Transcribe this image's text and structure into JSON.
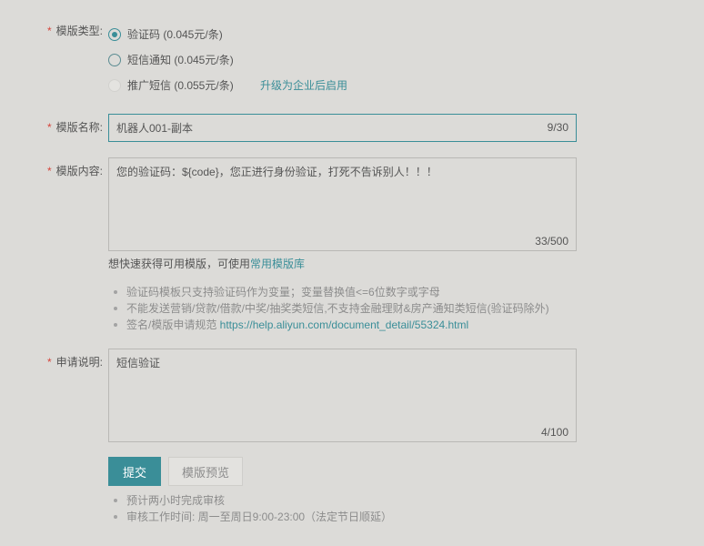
{
  "colors": {
    "background": "#dcdbd8",
    "accent": "#3a8e98",
    "required": "#d6453b",
    "text": "#555555",
    "muted": "#8c8c8c"
  },
  "template_type": {
    "required_mark": "*",
    "label": "模版类型:",
    "options": [
      {
        "label": "验证码 (0.045元/条)",
        "selected": true,
        "disabled": false
      },
      {
        "label": "短信通知 (0.045元/条)",
        "selected": false,
        "disabled": false
      },
      {
        "label": "推广短信 (0.055元/条)",
        "selected": false,
        "disabled": true
      }
    ],
    "upgrade_link": "升级为企业后启用"
  },
  "template_name": {
    "required_mark": "*",
    "label": "模版名称:",
    "value": "机器人001-副本",
    "counter": "9/30"
  },
  "template_content": {
    "required_mark": "*",
    "label": "模版内容:",
    "value": "您的验证码：${code}，您正进行身份验证，打死不告诉别人！！！",
    "counter": "33/500",
    "hint_prefix": "想快速获得可用模版，可使用",
    "hint_link": "常用模版库",
    "rules": [
      {
        "text": "验证码模板只支持验证码作为变量；变量替换值<=6位数字或字母"
      },
      {
        "text": "不能发送营销/贷款/借款/中奖/抽奖类短信,不支持金融理财&房产通知类短信(验证码除外)"
      },
      {
        "text": "签名/模版申请规范 ",
        "link": "https://help.aliyun.com/document_detail/55324.html"
      }
    ]
  },
  "application_note": {
    "required_mark": "*",
    "label": "申请说明:",
    "value": "短信验证",
    "counter": "4/100"
  },
  "actions": {
    "submit_label": "提交",
    "preview_label": "模版预览"
  },
  "review_notes": [
    "预计两小时完成审核",
    "审核工作时间: 周一至周日9:00-23:00（法定节日顺延）"
  ]
}
